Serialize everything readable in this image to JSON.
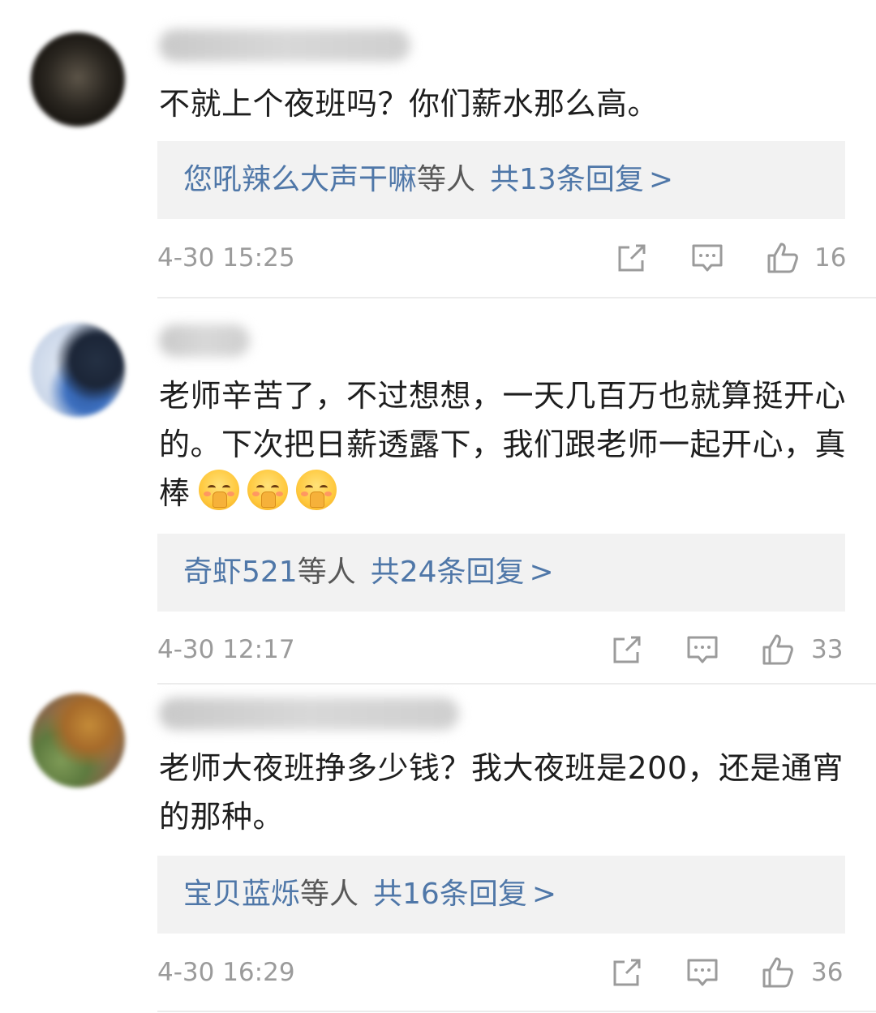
{
  "comments": [
    {
      "text": "不就上个夜班吗？你们薪水那么高。",
      "replies": {
        "names": "您吼辣么大声干嘛",
        "suffix": "等人",
        "total": "共13条回复",
        "arrow": ">"
      },
      "timestamp": "4-30 15:25",
      "likes": "16"
    },
    {
      "text": "老师辛苦了，不过想想，一天几百万也就算挺开心的。下次把日薪透露下，我们跟老师一起开心，真棒",
      "emoji": [
        "shy-hands-emoji",
        "shy-hands-emoji",
        "shy-hands-emoji"
      ],
      "replies": {
        "names": "奇虾521",
        "suffix": "等人",
        "total": "共24条回复",
        "arrow": ">"
      },
      "timestamp": "4-30 12:17",
      "likes": "33"
    },
    {
      "text": "老师大夜班挣多少钱？我大夜班是200，还是通宵的那种。",
      "replies": {
        "names": "宝贝蓝烁",
        "suffix": "等人",
        "total": "共16条回复",
        "arrow": ">"
      },
      "timestamp": "4-30 16:29",
      "likes": "36"
    }
  ],
  "icons": {
    "share": "share-icon",
    "comment": "comment-icon",
    "like": "thumbs-up-icon"
  },
  "colors": {
    "reply_link": "#4f77a8",
    "reply_bg": "#f2f2f2",
    "meta_gray": "#9b9b9b"
  }
}
